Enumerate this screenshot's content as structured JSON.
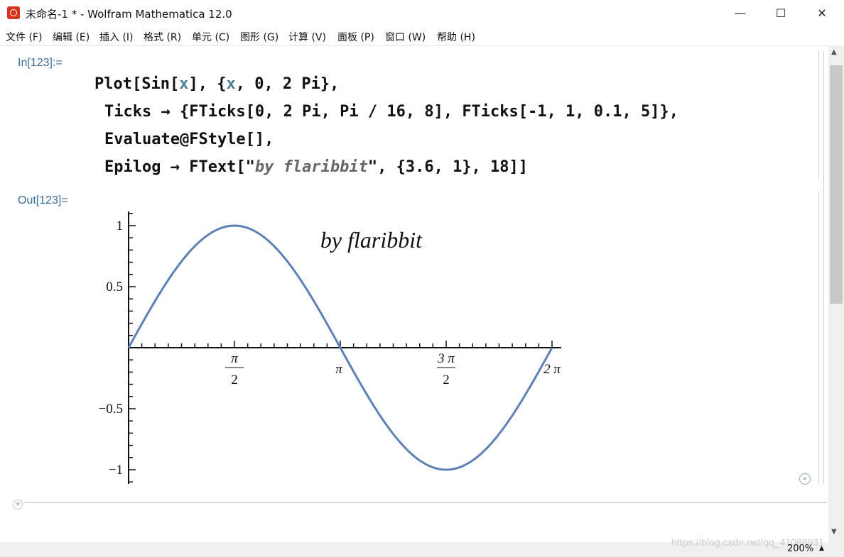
{
  "window": {
    "title": "未命名-1 * - Wolfram Mathematica 12.0",
    "minimize": "—",
    "maximize": "☐",
    "close": "✕"
  },
  "menu": [
    "文件 (F)",
    "编辑 (E)",
    "插入 (I)",
    "格式 (R)",
    "单元 (C)",
    "图形 (G)",
    "计算 (V)",
    "面板 (P)",
    "窗口 (W)",
    "帮助 (H)"
  ],
  "cells": {
    "in_label": "In[123]:=",
    "out_label": "Out[123]="
  },
  "code": {
    "line1": [
      "Plot[Sin[",
      "x",
      "], {",
      "x",
      ", 0, 2 Pi},"
    ],
    "line2": "Ticks → {FTicks[0, 2 Pi, Pi / 16, 8], FTicks[-1, 1, 0.1, 5]},",
    "line3": "Evaluate@FStyle[],",
    "line4": [
      "Epilog → FText[\"",
      "by flaribbit",
      "\", {3.6, 1}, 18]]"
    ]
  },
  "chart_data": {
    "type": "line",
    "function": "Sin[x]",
    "xlim": [
      0,
      6.2832
    ],
    "ylim": [
      -1,
      1
    ],
    "x_tick_labels": [
      {
        "x": 1.5708,
        "num": "π",
        "den": "2"
      },
      {
        "x": 3.1416,
        "text": "π"
      },
      {
        "x": 4.7124,
        "num": "3 π",
        "den": "2"
      },
      {
        "x": 6.2832,
        "text": "2 π"
      }
    ],
    "y_tick_labels": [
      {
        "y": 1,
        "text": "1"
      },
      {
        "y": 0.5,
        "text": "0.5"
      },
      {
        "y": -0.5,
        "text": "−0.5"
      },
      {
        "y": -1,
        "text": "−1"
      }
    ],
    "annotation": {
      "x": 3.6,
      "y": 1,
      "text": "by  flaribbit"
    },
    "line_color": "#5e81b5"
  },
  "status": {
    "zoom": "200%",
    "watermark": "https://blog.csdn.net/qq_41088931"
  }
}
